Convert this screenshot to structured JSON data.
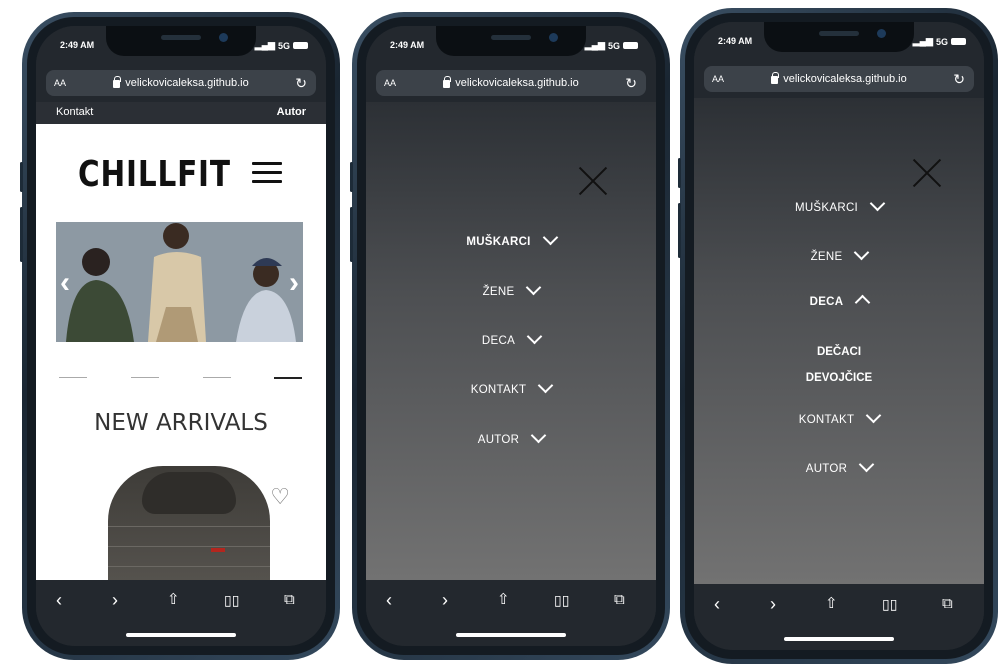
{
  "status": {
    "time": "2:49 AM",
    "signal": "5G"
  },
  "browser": {
    "aa": "AA",
    "url": "velickovicaleksa.github.io",
    "reload": "↻"
  },
  "toolbar": {
    "back": "‹",
    "forward": "›",
    "share": "⇧",
    "bookmarks": "📖",
    "tabs": "⧉"
  },
  "phone1": {
    "topbar": {
      "contact": "Kontakt",
      "author": "Autor"
    },
    "logo": "CHILLFIT",
    "heading": "NEW ARRIVALS",
    "slider": {
      "prev": "‹",
      "next": "›",
      "active_slide": 4,
      "slides": 4
    }
  },
  "phone2": {
    "menu": [
      {
        "label": "MUŠKARCI",
        "bold": true
      },
      {
        "label": "ŽENE",
        "bold": false
      },
      {
        "label": "DECA",
        "bold": false
      },
      {
        "label": "KONTAKT",
        "bold": false
      },
      {
        "label": "AUTOR",
        "bold": false
      }
    ]
  },
  "phone3": {
    "menu": [
      {
        "label": "MUŠKARCI"
      },
      {
        "label": "ŽENE"
      },
      {
        "label": "DECA",
        "expanded": true
      },
      {
        "label": "KONTAKT"
      },
      {
        "label": "AUTOR"
      }
    ],
    "submenu": [
      "DEČACI",
      "DEVOJČICE"
    ]
  },
  "colors": {
    "screen_bg": "#23282e",
    "menu_gradient_top": "#2c3035",
    "menu_gradient_bottom": "#727272",
    "page_bg": "#ffffff"
  }
}
